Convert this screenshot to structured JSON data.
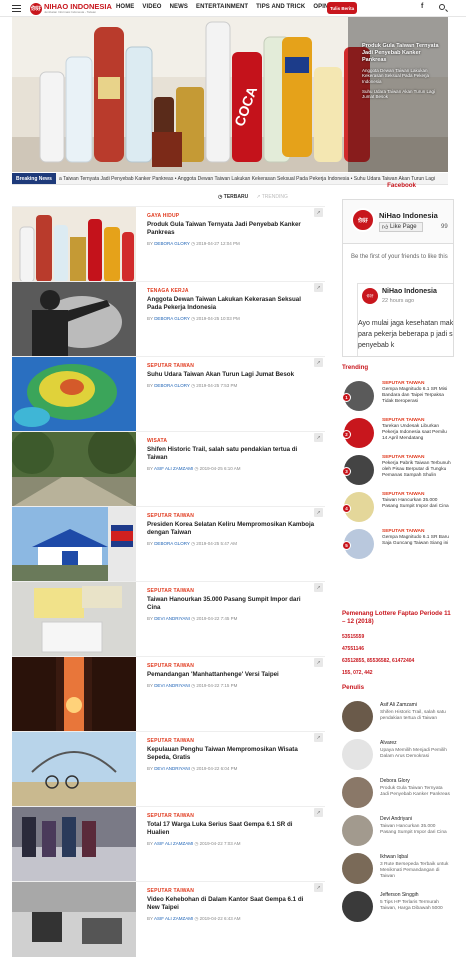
{
  "nav": {
    "logo_mark": "你好",
    "logo_name": "NIHAO INDONESIA",
    "logo_tagline": "Jembatan Informasi Indonesia - Taiwan",
    "menu": [
      "HOME",
      "VIDEO",
      "NEWS",
      "ENTERTAINMENT",
      "TIPS AND TRICK",
      "OPINI"
    ],
    "write_button": "Tulis Berita",
    "fb_icon": "f",
    "search_icon": "search-icon"
  },
  "hero": {
    "side_headline": "Produk Gula Taiwan Ternyata Jadi Penyebab Kanker Pankreas",
    "side_second": "Anggota Dewan Taiwan Lakukan Kekerasan Seksual Pada Pekerja Indonesia",
    "side_third": "Suhu Udara Taiwan Akan Turun Lagi Jumat Besok",
    "prev": "‹",
    "next": "›"
  },
  "breaking": {
    "label": "Breaking News",
    "ticker": "a Taiwan Ternyata Jadi Penyebab Kanker Pankreas  •  Anggota Dewan Taiwan Lakukan Kekerasan Seksual Pada Pekerja Indonesia  •  Suhu Udara Taiwan Akan Turun Lagi"
  },
  "tabs": {
    "latest": "TERBARU",
    "trending": "TRENDING"
  },
  "articles": [
    {
      "category": "GAYA HIDUP",
      "title": "Produk Gula Taiwan Ternyata Jadi Penyebab Kanker Pankreas",
      "by": "BY",
      "author": "DEBORA GLORY",
      "date": "2019-04-27 12:04 PM"
    },
    {
      "category": "TENAGA KERJA",
      "title": "Anggota Dewan Taiwan Lakukan Kekerasan Seksual Pada Pekerja Indonesia",
      "by": "BY",
      "author": "DEBORA GLORY",
      "date": "2019-04-25 10:03 PM"
    },
    {
      "category": "SEPUTAR TAIWAN",
      "title": "Suhu Udara Taiwan Akan Turun Lagi Jumat Besok",
      "by": "BY",
      "author": "DEBORA GLORY",
      "date": "2019-04-25 7:53 PM"
    },
    {
      "category": "WISATA",
      "title": "Shifen Historic Trail, salah satu pendakian tertua di Taiwan",
      "by": "BY",
      "author": "ASIF ALI ZAMZAMI",
      "date": "2019-04-25 6:10 AM"
    },
    {
      "category": "SEPUTAR TAIWAN",
      "title": "Presiden Korea Selatan Keliru Mempromosikan Kamboja dengan Taiwan",
      "by": "BY",
      "author": "DEBORA GLORY",
      "date": "2019-04-25 5:47 AM"
    },
    {
      "category": "SEPUTAR TAIWAN",
      "title": "Taiwan Hanourkan 35.000 Pasang Sumpit Impor dari Cina",
      "by": "BY",
      "author": "DEVI ANDRIYANI",
      "date": "2019-04-22 7:45 PM"
    },
    {
      "category": "SEPUTAR TAIWAN",
      "title": "Pemandangan 'Manhattanhenge' Versi Taipei",
      "by": "BY",
      "author": "DEVI ANDRIYANI",
      "date": "2019-04-22 7:15 PM"
    },
    {
      "category": "SEPUTAR TAIWAN",
      "title": "Kepulauan Penghu Taiwan Mempromosikan Wisata Sepeda, Gratis",
      "by": "BY",
      "author": "DEVI ANDRIYANI",
      "date": "2019-04-22 6:04 PM"
    },
    {
      "category": "SEPUTAR TAIWAN",
      "title": "Total 17 Warga Luka Serius Saat Gempa 6.1 SR di Hualien",
      "by": "BY",
      "author": "ASIF ALI ZAMZAMI",
      "date": "2019-04-22 7:03 AM"
    },
    {
      "category": "SEPUTAR TAIWAN",
      "title": "Video Kehebohan di Dalam Kantor Saat Gempa 6.1 di New Taipei",
      "by": "BY",
      "author": "ASIF ALI ZAMZAMI",
      "date": "2019-04-22 6:43 AM"
    }
  ],
  "facebook": {
    "title": "Facebook",
    "page_name": "NiHao Indonesia",
    "like_label": "Like Page",
    "count": "99",
    "first_text": "Be the first of your friends to like this",
    "post_name": "NiHao Indonesia",
    "post_time": "22 hours ago",
    "post_body": "Ayo mulai jaga kesehatan makanan bergula, para pekerja beberapa p jadi sumber penyebab k"
  },
  "trending": {
    "title": "Trending",
    "items": [
      {
        "num": "1",
        "category": "SEPUTAR TAIWAN",
        "title": "Gempa Magnitudo 6.1 SR Misi Bandara dan Taipei Terpaksa Tidak Beroperasi"
      },
      {
        "num": "2",
        "category": "SEPUTAR TAIWAN",
        "title": "Tarekan Undesak Liburkan Pekerja Indonesia saat Pemilu 14 April Mendatang"
      },
      {
        "num": "3",
        "category": "SEPUTAR TAIWAN",
        "title": "Pekerja Pabrik Taiwan Terbunuh oleh Pisau Berputar di Tungku Pemanas Sampah Shulin"
      },
      {
        "num": "4",
        "category": "SEPUTAR TAIWAN",
        "title": "Taiwan Hancurkan 35.000 Pasang Sumpit Impor dari Cina"
      },
      {
        "num": "5",
        "category": "SEPUTAR TAIWAN",
        "title": "Gempa Magnitudo 6.1 SR Baru Saja Guncang Taiwan Siang ini"
      }
    ]
  },
  "lottery": {
    "title": "Pemenang Lottere Faptao Periode 11 – 12 (2018)",
    "numbers": [
      "53515559",
      "47551146",
      "63512855, 85536582, 61472404",
      "155, 072, 442"
    ]
  },
  "writers": {
    "title": "Penulis",
    "items": [
      {
        "name": "Asif Ali Zamzami",
        "desc": "Shifen Historic Trail, salah satu pendakian tertua di Taiwan"
      },
      {
        "name": "Alvarez",
        "desc": "Upaya Memilih Menjadi Pemilih Dalam Arus Demokrasi"
      },
      {
        "name": "Debora Glory",
        "desc": "Produk Gula Taiwan Ternyata Jadi Penyebab Kanker Pankreas"
      },
      {
        "name": "Devi Andriyani",
        "desc": "Taiwan Hancurkan 35.000 Pasang Sumpit Impor dari Cina"
      },
      {
        "name": "Ikhwan Iqbal",
        "desc": "3 Rute Bersepeda Terbaik untuk Menikmati Pemandangan di Taiwan"
      },
      {
        "name": "Jefferson Singgih",
        "desc": "5 Tips HP Terlaris Termurah Taiwan, Harga Dibawah 5000"
      }
    ]
  },
  "colors": {
    "brand": "#c8161d",
    "accent": "#e03a1e",
    "link": "#1e63b6",
    "breaking": "#1e3a7a"
  }
}
